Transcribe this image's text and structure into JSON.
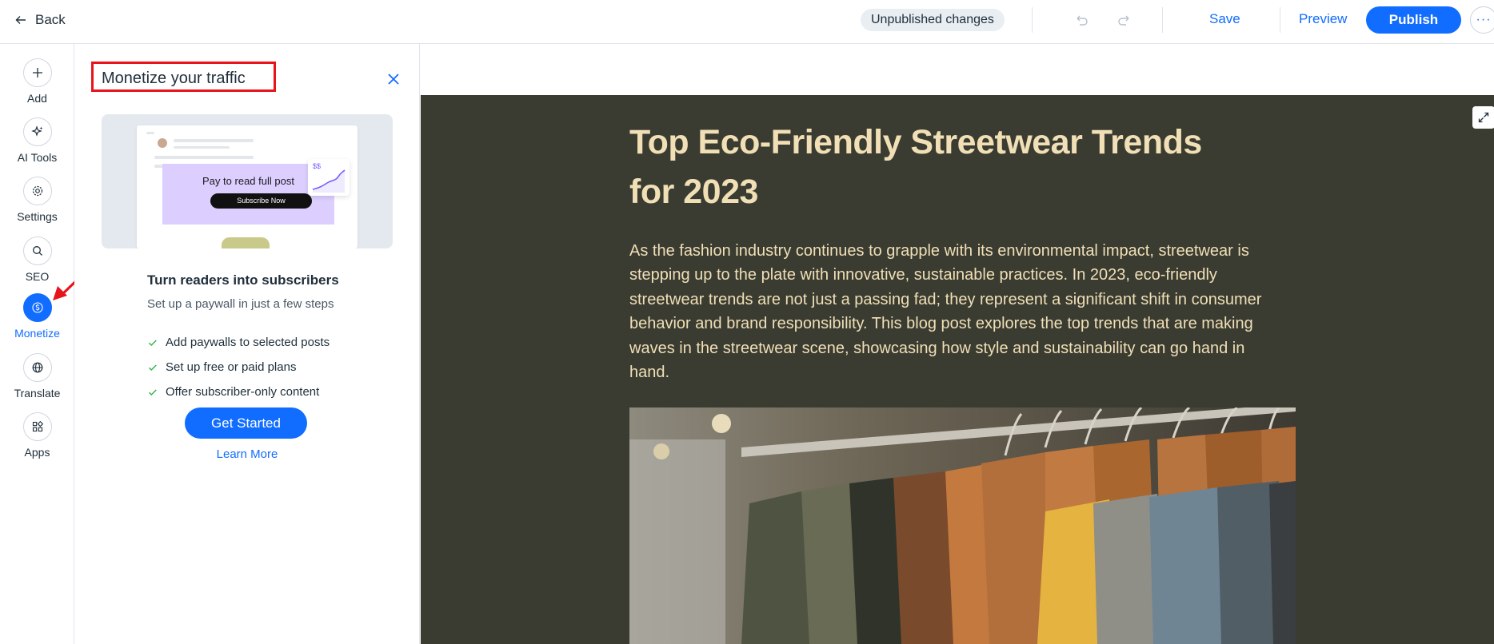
{
  "topbar": {
    "back_label": "Back",
    "status": "Unpublished changes",
    "save_label": "Save",
    "preview_label": "Preview",
    "publish_label": "Publish",
    "more_label": "···"
  },
  "rail": {
    "items": [
      {
        "label": "Add",
        "icon": "plus-icon"
      },
      {
        "label": "AI Tools",
        "icon": "sparkle-icon"
      },
      {
        "label": "Settings",
        "icon": "gear-icon"
      },
      {
        "label": "SEO",
        "icon": "search-icon"
      },
      {
        "label": "Monetize",
        "icon": "dollar-icon",
        "active": true
      },
      {
        "label": "Translate",
        "icon": "globe-icon"
      },
      {
        "label": "Apps",
        "icon": "apps-icon"
      }
    ]
  },
  "panel": {
    "title": "Monetize your traffic",
    "preview": {
      "paywall_text": "Pay to read full post",
      "subscribe_label": "Subscribe Now",
      "chart_label": "$$"
    },
    "heading": "Turn readers into subscribers",
    "subheading": "Set up a paywall in just a few steps",
    "features": [
      "Add paywalls to selected posts",
      "Set up free or paid plans",
      "Offer subscriber-only content"
    ],
    "cta_label": "Get Started",
    "learn_more_label": "Learn More"
  },
  "article": {
    "title": "Top Eco-Friendly Streetwear Trends for 2023",
    "body": "As the fashion industry continues to grapple with its environmental impact, streetwear is stepping up to the plate with innovative, sustainable practices. In 2023, eco-friendly streetwear trends are not just a passing fad; they represent a significant shift in consumer behavior and brand responsibility. This blog post explores the top trends that are making waves in the streetwear scene, showcasing how style and sustainability can go hand in hand."
  },
  "colors": {
    "accent": "#116dff",
    "article_bg": "#3a3c32",
    "article_text": "#f1dfb6",
    "highlight_box": "#e8141b"
  }
}
